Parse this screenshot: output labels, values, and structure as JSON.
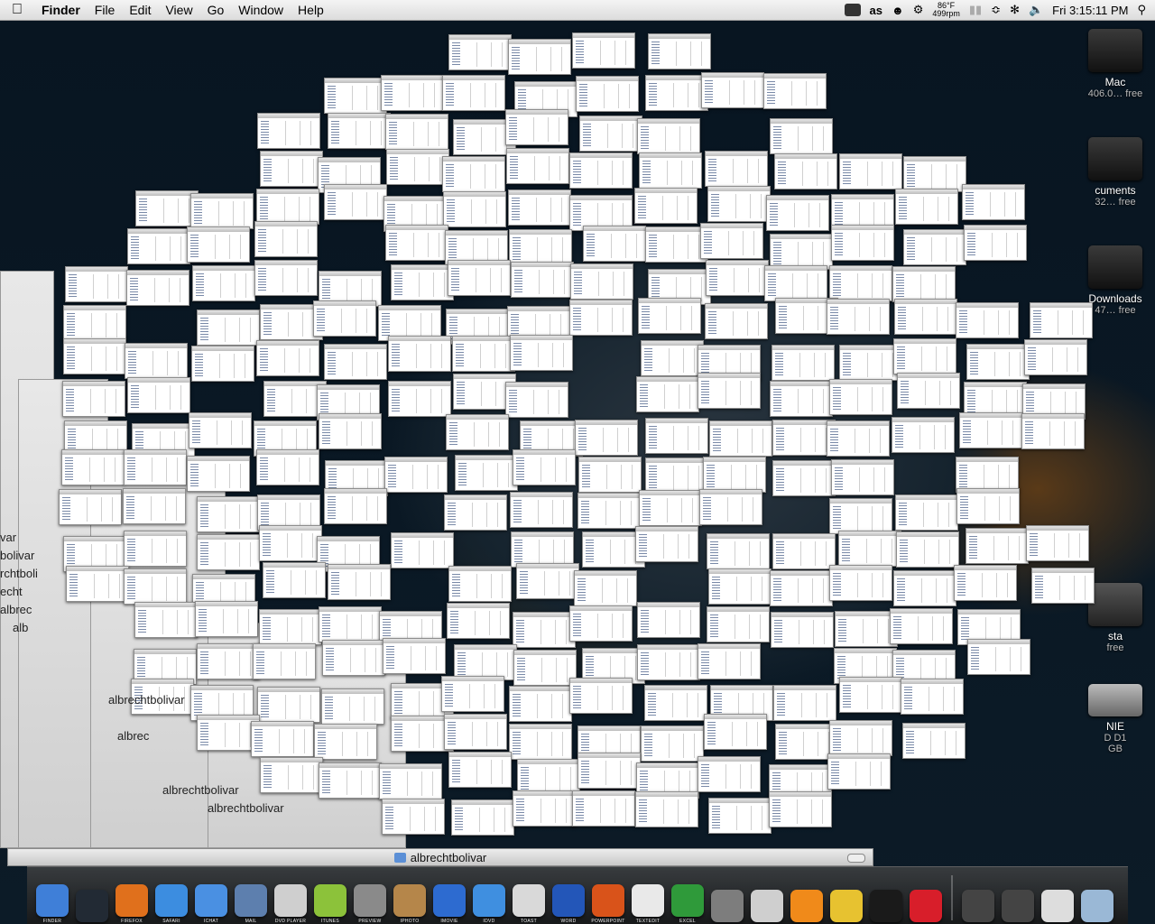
{
  "menubar": {
    "apple": "",
    "items": [
      "Finder",
      "File",
      "Edit",
      "View",
      "Go",
      "Window",
      "Help"
    ],
    "status": {
      "temp": "86°F",
      "fan": "499rpm",
      "clock": "Fri 3:15:11 PM"
    }
  },
  "desktop_icons": [
    {
      "name": "Mac",
      "sub": "406.0… free"
    },
    {
      "name": "cuments",
      "sub": "32… free"
    },
    {
      "name": "Downloads",
      "sub": "47… free"
    },
    {
      "name": "sta",
      "sub": "free"
    },
    {
      "name": "NIE",
      "sub": "D D1"
    },
    {
      "name": "",
      "sub": "GB"
    }
  ],
  "background_windows": {
    "labels": [
      "var",
      "bolivar",
      "rchtboli",
      "echt",
      "albrec",
      "alb",
      "albrechtbolivar",
      "albrec",
      "albrechtbolivar",
      "albrechtbolivar"
    ]
  },
  "front_window": {
    "title": "albrechtbolivar"
  },
  "dock": {
    "apps": [
      {
        "label": "FINDER",
        "color": "#3f7fd8"
      },
      {
        "label": "",
        "color": "#222a34"
      },
      {
        "label": "FIREFOX",
        "color": "#e0701c"
      },
      {
        "label": "SAFARI",
        "color": "#3c8de0"
      },
      {
        "label": "ICHAT",
        "color": "#4a90e2"
      },
      {
        "label": "MAIL",
        "color": "#5d7fae"
      },
      {
        "label": "DVD PLAYER",
        "color": "#cfcfcf"
      },
      {
        "label": "ITUNES",
        "color": "#8cc23a"
      },
      {
        "label": "PREVIEW",
        "color": "#8a8a8a"
      },
      {
        "label": "IPHOTO",
        "color": "#b5864a"
      },
      {
        "label": "IMOVIE",
        "color": "#2d6bd0"
      },
      {
        "label": "IDVD",
        "color": "#3f8fe0"
      },
      {
        "label": "TOAST",
        "color": "#d9d9d9"
      },
      {
        "label": "WORD",
        "color": "#2356b8"
      },
      {
        "label": "POWERPOINT",
        "color": "#d9531a"
      },
      {
        "label": "TEXTEDIT",
        "color": "#e9e9e9"
      },
      {
        "label": "EXCEL",
        "color": "#2f9a3a"
      },
      {
        "label": "",
        "color": "#7d7d7d"
      },
      {
        "label": "",
        "color": "#cfcfcf"
      },
      {
        "label": "",
        "color": "#f08a1a"
      },
      {
        "label": "",
        "color": "#e7c230"
      },
      {
        "label": "",
        "color": "#1a1a1a"
      },
      {
        "label": "",
        "color": "#d81e2a"
      }
    ],
    "right_items": [
      {
        "label": "",
        "color": "#444"
      },
      {
        "label": "",
        "color": "#444"
      },
      {
        "label": "",
        "color": "#ddd"
      },
      {
        "label": "",
        "color": "#9ab8d6"
      }
    ]
  }
}
